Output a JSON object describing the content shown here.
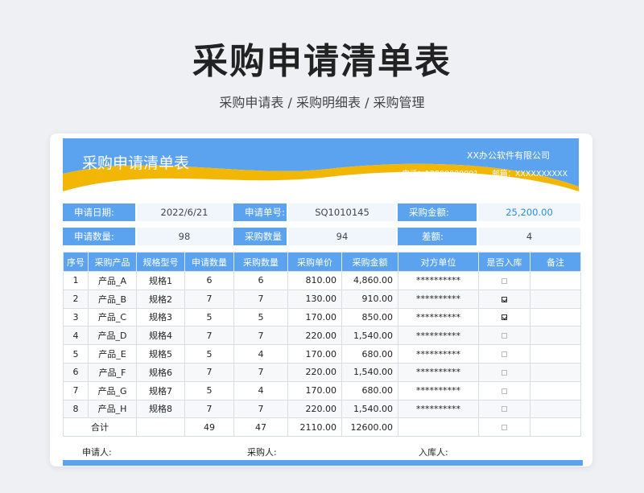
{
  "page": {
    "title": "采购申请清单表",
    "subtitle": "采购申请表 / 采购明细表 / 采购管理"
  },
  "banner": {
    "title": "采购申请清单表",
    "company": "XX办公软件有限公司",
    "phone": "电话：13800000001",
    "email": "邮箱：XXXXXXXXXX"
  },
  "colors": {
    "accent": "#5ba3ef",
    "banner_blue": "#5ba3ef",
    "banner_gold": "#f2b705"
  },
  "info": {
    "apply_date_label": "申请日期:",
    "apply_date": "2022/6/21",
    "apply_no_label": "申请单号:",
    "apply_no": "SQ1010145",
    "purchase_amount_label": "采购金额:",
    "purchase_amount": "25,200.00",
    "apply_qty_label": "申请数量:",
    "apply_qty": "98",
    "purchase_qty_label": "采购数量",
    "purchase_qty": "94",
    "diff_label": "差额:",
    "diff": "4"
  },
  "table": {
    "headers": [
      "序号",
      "采购产品",
      "规格型号",
      "申请数量",
      "采购数量",
      "采购单价",
      "采购金额",
      "对方单位",
      "是否入库",
      "备注"
    ],
    "rows": [
      {
        "no": "1",
        "product": "产品_A",
        "spec": "规格1",
        "apply": "6",
        "buy": "6",
        "price": "810.00",
        "amount": "4,860.00",
        "vendor": "**********",
        "stored": false,
        "note": ""
      },
      {
        "no": "2",
        "product": "产品_B",
        "spec": "规格2",
        "apply": "7",
        "buy": "7",
        "price": "130.00",
        "amount": "910.00",
        "vendor": "**********",
        "stored": true,
        "note": ""
      },
      {
        "no": "3",
        "product": "产品_C",
        "spec": "规格3",
        "apply": "5",
        "buy": "5",
        "price": "170.00",
        "amount": "850.00",
        "vendor": "**********",
        "stored": true,
        "note": ""
      },
      {
        "no": "4",
        "product": "产品_D",
        "spec": "规格4",
        "apply": "7",
        "buy": "7",
        "price": "220.00",
        "amount": "1,540.00",
        "vendor": "**********",
        "stored": false,
        "note": ""
      },
      {
        "no": "5",
        "product": "产品_E",
        "spec": "规格5",
        "apply": "5",
        "buy": "4",
        "price": "170.00",
        "amount": "680.00",
        "vendor": "**********",
        "stored": false,
        "note": ""
      },
      {
        "no": "6",
        "product": "产品_F",
        "spec": "规格6",
        "apply": "7",
        "buy": "7",
        "price": "220.00",
        "amount": "1,540.00",
        "vendor": "**********",
        "stored": false,
        "note": ""
      },
      {
        "no": "7",
        "product": "产品_G",
        "spec": "规格7",
        "apply": "5",
        "buy": "4",
        "price": "170.00",
        "amount": "680.00",
        "vendor": "**********",
        "stored": false,
        "note": ""
      },
      {
        "no": "8",
        "product": "产品_H",
        "spec": "规格8",
        "apply": "7",
        "buy": "7",
        "price": "220.00",
        "amount": "1,540.00",
        "vendor": "**********",
        "stored": false,
        "note": ""
      }
    ],
    "total": {
      "label": "合计",
      "apply": "49",
      "buy": "47",
      "price": "2110.00",
      "amount": "12600.00",
      "stored": false
    }
  },
  "sign": {
    "applicant": "申请人:",
    "purchaser": "采购人:",
    "receiver": "入库人:"
  }
}
